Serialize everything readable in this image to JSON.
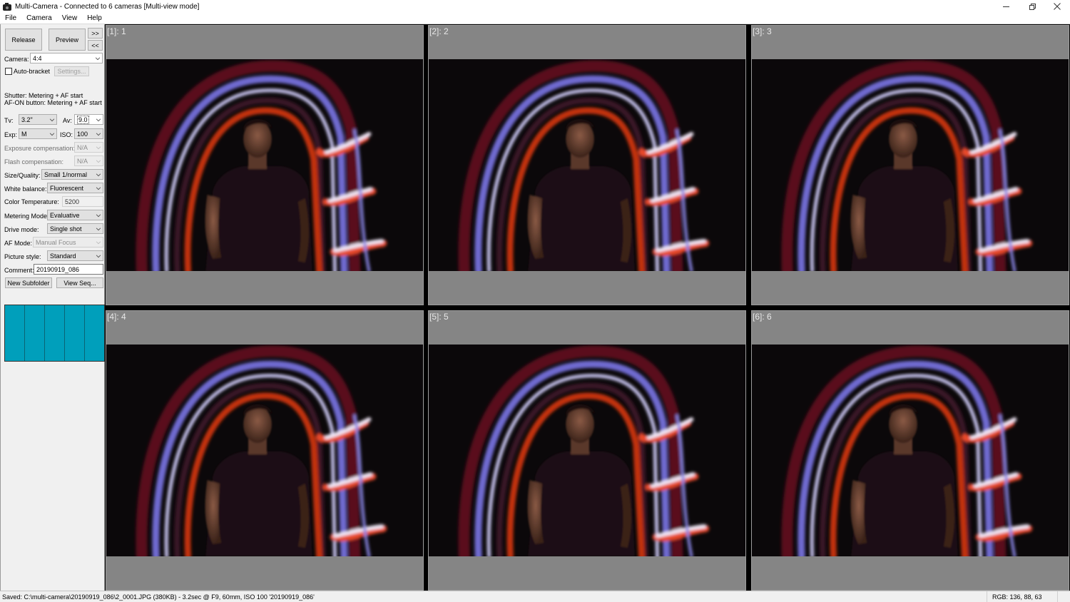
{
  "window": {
    "title": "Multi-Camera - Connected to 6 cameras [Multi-view mode]",
    "app_icon": "camera-icon",
    "controls": [
      "minimize",
      "restore",
      "close"
    ]
  },
  "menu": [
    "File",
    "Camera",
    "View",
    "Help"
  ],
  "sidebar": {
    "release_label": "Release",
    "preview_label": "Preview",
    "next_label": ">>",
    "prev_label": "<<",
    "camera_label": "Camera:",
    "camera_value": "4:4",
    "auto_bracket_label": "Auto-bracket",
    "auto_bracket_checked": false,
    "settings_label": "Settings...",
    "shutter_info": "Shutter: Metering + AF start",
    "afon_info": "AF-ON button: Metering + AF start",
    "tv_label": "Tv:",
    "tv_value": "3.2\"",
    "av_label": "Av:",
    "av_value": "9.0",
    "exp_label": "Exp:",
    "exp_value": "M",
    "iso_label": "ISO:",
    "iso_value": "100",
    "exposure_comp_label": "Exposure compensation:",
    "exposure_comp_value": "N/A",
    "flash_comp_label": "Flash compensation:",
    "flash_comp_value": "N/A",
    "size_quality_label": "Size/Quality:",
    "size_quality_value": "Small 1/normal",
    "white_balance_label": "White balance:",
    "white_balance_value": "Fluorescent",
    "color_temp_label": "Color Temperature:",
    "color_temp_value": "5200",
    "metering_label": "Metering Mode:",
    "metering_value": "Evaluative",
    "drive_label": "Drive mode:",
    "drive_value": "Single shot",
    "af_mode_label": "AF Mode:",
    "af_mode_value": "Manual Focus",
    "picture_style_label": "Picture style:",
    "picture_style_value": "Standard",
    "comment_label": "Comment:",
    "comment_value": "20190919_086",
    "new_subfolder_label": "New Subfolder",
    "view_seq_label": "View Seq...",
    "progress": {
      "segments": 5,
      "filled_segments": 5,
      "color": "#009fbb"
    }
  },
  "cameras": [
    {
      "label": "[1]: 1"
    },
    {
      "label": "[2]: 2"
    },
    {
      "label": "[3]: 3"
    },
    {
      "label": "[4]: 4"
    },
    {
      "label": "[5]: 5"
    },
    {
      "label": "[6]: 6"
    }
  ],
  "status": {
    "saved_text": "Saved: C:\\multi-camera\\20190919_086\\2_0001.JPG (380KB) - 3.2sec @ F9, 60mm, ISO 100 '20190919_086'",
    "rgb_text": "RGB: 136, 88, 63"
  }
}
